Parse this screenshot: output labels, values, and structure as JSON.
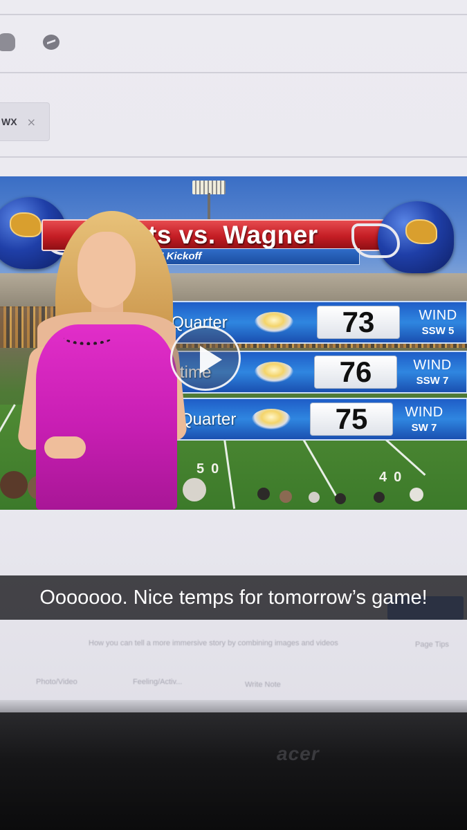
{
  "browser": {
    "tag_chip": {
      "label": "WX",
      "close_glyph": "×"
    }
  },
  "video": {
    "banner_title": "ts vs. Wagner",
    "kickoff_text": "PM Kickoff",
    "forecast": [
      {
        "label": "t Quarter",
        "temp": "73",
        "wind_label": "WIND",
        "wind_value": "SSW 5"
      },
      {
        "label": "lftime",
        "temp": "76",
        "wind_label": "WIND",
        "wind_value": "SSW 7"
      },
      {
        "label": "Quarter",
        "temp": "75",
        "wind_label": "WIND",
        "wind_value": "SW 7"
      }
    ],
    "field_numbers": [
      "50",
      "40"
    ],
    "play_button": "play-icon"
  },
  "caption": {
    "text": "Ooooooo. Nice temps for tomorrow’s game!"
  },
  "below_ui": {
    "hint_text": "How you can tell a more immersive story by combining images and videos",
    "actions": [
      "Photo/Video",
      "Feeling/Activ...",
      "Write Note"
    ],
    "side_label": "Page Tips"
  },
  "monitor": {
    "brand": "acer"
  },
  "colors": {
    "banner_red": "#c41d24",
    "forecast_blue": "#2f86e0",
    "dress_magenta": "#e12ec9",
    "caption_bg": "#1e1e22"
  }
}
